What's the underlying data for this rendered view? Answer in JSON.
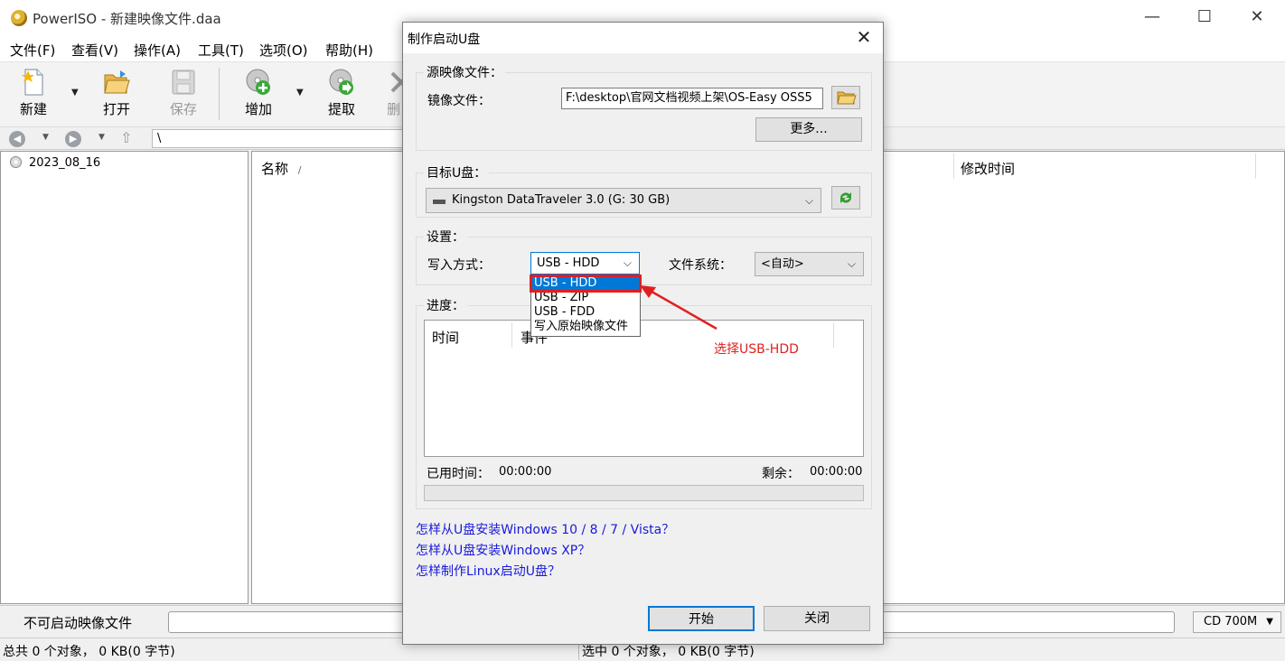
{
  "app": {
    "title": "PowerISO - 新建映像文件.daa",
    "min_glyph": "—",
    "max_glyph": "☐",
    "close_glyph": "✕"
  },
  "menu": [
    "文件(F)",
    "查看(V)",
    "操作(A)",
    "工具(T)",
    "选项(O)",
    "帮助(H)"
  ],
  "toolbar": {
    "new": "新建",
    "open": "打开",
    "save": "保存",
    "add": "增加",
    "extract": "提取",
    "delete_partial": "删"
  },
  "address": {
    "path": "\\"
  },
  "tree": {
    "item": "2023_08_16"
  },
  "list": {
    "col_name": "名称",
    "sort_glyph": "/",
    "col_modified": "修改时间"
  },
  "status": {
    "disc_type": "不可启动映像文件",
    "media": "CD 700M",
    "total": "总共 0 个对象， 0 KB(0 字节)",
    "selected": "选中 0 个对象， 0 KB(0 字节)"
  },
  "dialog": {
    "title": "制作启动U盘",
    "source_group": "源映像文件：",
    "image_label": "镜像文件：",
    "image_path": "F:\\desktop\\官网文档视频上架\\OS-Easy OSS5",
    "more_button": "更多...",
    "target_group": "目标U盘：",
    "target_drive": "Kingston DataTraveler 3.0 (G: 30 GB)",
    "settings_group": "设置：",
    "write_mode_label": "写入方式：",
    "write_mode_value": "USB - HDD",
    "write_mode_options": [
      "USB - HDD",
      "USB - ZIP",
      "USB - FDD",
      "写入原始映像文件"
    ],
    "fs_label": "文件系统：",
    "fs_value": "<自动>",
    "progress_group": "进度：",
    "col_time": "时间",
    "col_event": "事件",
    "elapsed_label": "已用时间：",
    "elapsed_value": "00:00:00",
    "remaining_label": "剩余：",
    "remaining_value": "00:00:00",
    "progress": 0,
    "links": [
      "怎样从U盘安装Windows 10 / 8 / 7 / Vista？",
      "怎样从U盘安装Windows XP？",
      "怎样制作Linux启动U盘？"
    ],
    "start_button": "开始",
    "close_button": "关闭"
  },
  "annotation": {
    "text": "选择USB-HDD",
    "color": "#e02020"
  },
  "colors": {
    "selection": "#0078d7",
    "link": "#1a1adc",
    "highlight": "#e02020"
  }
}
